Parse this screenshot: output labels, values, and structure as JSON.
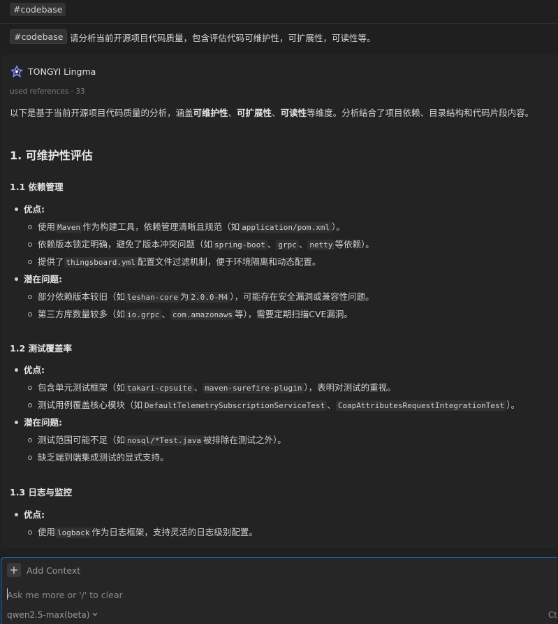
{
  "context_tag": "#codebase",
  "query": {
    "tag": "#codebase",
    "text": "请分析当前开源项目代码质量，包含评估代码可维护性，可扩展性，可读性等。"
  },
  "answer": {
    "assistant_name": "TONGYI Lingma",
    "references": "used references · 33",
    "intro": {
      "t1": "以下是基于当前开源项目代码质量的分析，涵盖",
      "b1": "可维护性",
      "t2": "、",
      "b2": "可扩展性",
      "t3": "、",
      "b3": "可读性",
      "t4": "等维度。分析结合了项目依赖、目录结构和代码片段内容。"
    },
    "h2": "1. 可维护性评估",
    "s11": {
      "title": "1.1 依赖管理",
      "pros_label": "优点:",
      "p1": {
        "a": "使用",
        "c1": "Maven",
        "b": "作为构建工具，依赖管理清晰且规范（如",
        "c2": "application/pom.xml",
        "d": "）。"
      },
      "p2": {
        "a": "依赖版本锁定明确，避免了版本冲突问题（如",
        "c1": "spring-boot",
        "b": "、",
        "c2": "grpc",
        "c": "、",
        "c3": "netty",
        "d": "等依赖）。"
      },
      "p3": {
        "a": "提供了",
        "c1": "thingsboard.yml",
        "b": "配置文件过滤机制，便于环境隔离和动态配置。"
      },
      "cons_label": "潜在问题:",
      "c1": {
        "a": "部分依赖版本较旧（如",
        "c1": "leshan-core",
        "b": "为",
        "c2": "2.0.0-M4",
        "d": "），可能存在安全漏洞或兼容性问题。"
      },
      "c2": {
        "a": "第三方库数量较多（如",
        "c1": "io.grpc",
        "b": "、",
        "c2": "com.amazonaws",
        "d": "等），需要定期扫描CVE漏洞。"
      }
    },
    "s12": {
      "title": "1.2 测试覆盖率",
      "pros_label": "优点:",
      "p1": {
        "a": "包含单元测试框架（如",
        "c1": "takari-cpsuite",
        "b": "、",
        "c2": "maven-surefire-plugin",
        "d": "），表明对测试的重视。"
      },
      "p2": {
        "a": "测试用例覆盖核心模块（如",
        "c1": "DefaultTelemetrySubscriptionServiceTest",
        "b": "、",
        "c2": "CoapAttributesRequestIntegrationTest",
        "d": "）。"
      },
      "cons_label": "潜在问题:",
      "c1": {
        "a": "测试范围可能不足（如",
        "c1": "nosql/*Test.java",
        "b": "被排除在测试之外）。"
      },
      "c2": {
        "a": "缺乏端到端集成测试的显式支持。"
      }
    },
    "s13": {
      "title": "1.3 日志与监控",
      "pros_label": "优点:",
      "p1": {
        "a": "使用",
        "c1": "logback",
        "b": "作为日志框架，支持灵活的日志级别配置。"
      }
    }
  },
  "input": {
    "add_context": "Add Context",
    "placeholder": "Ask me more or '/' to clear",
    "model": "qwen2.5-max(beta)",
    "shortcut": "Ct"
  }
}
